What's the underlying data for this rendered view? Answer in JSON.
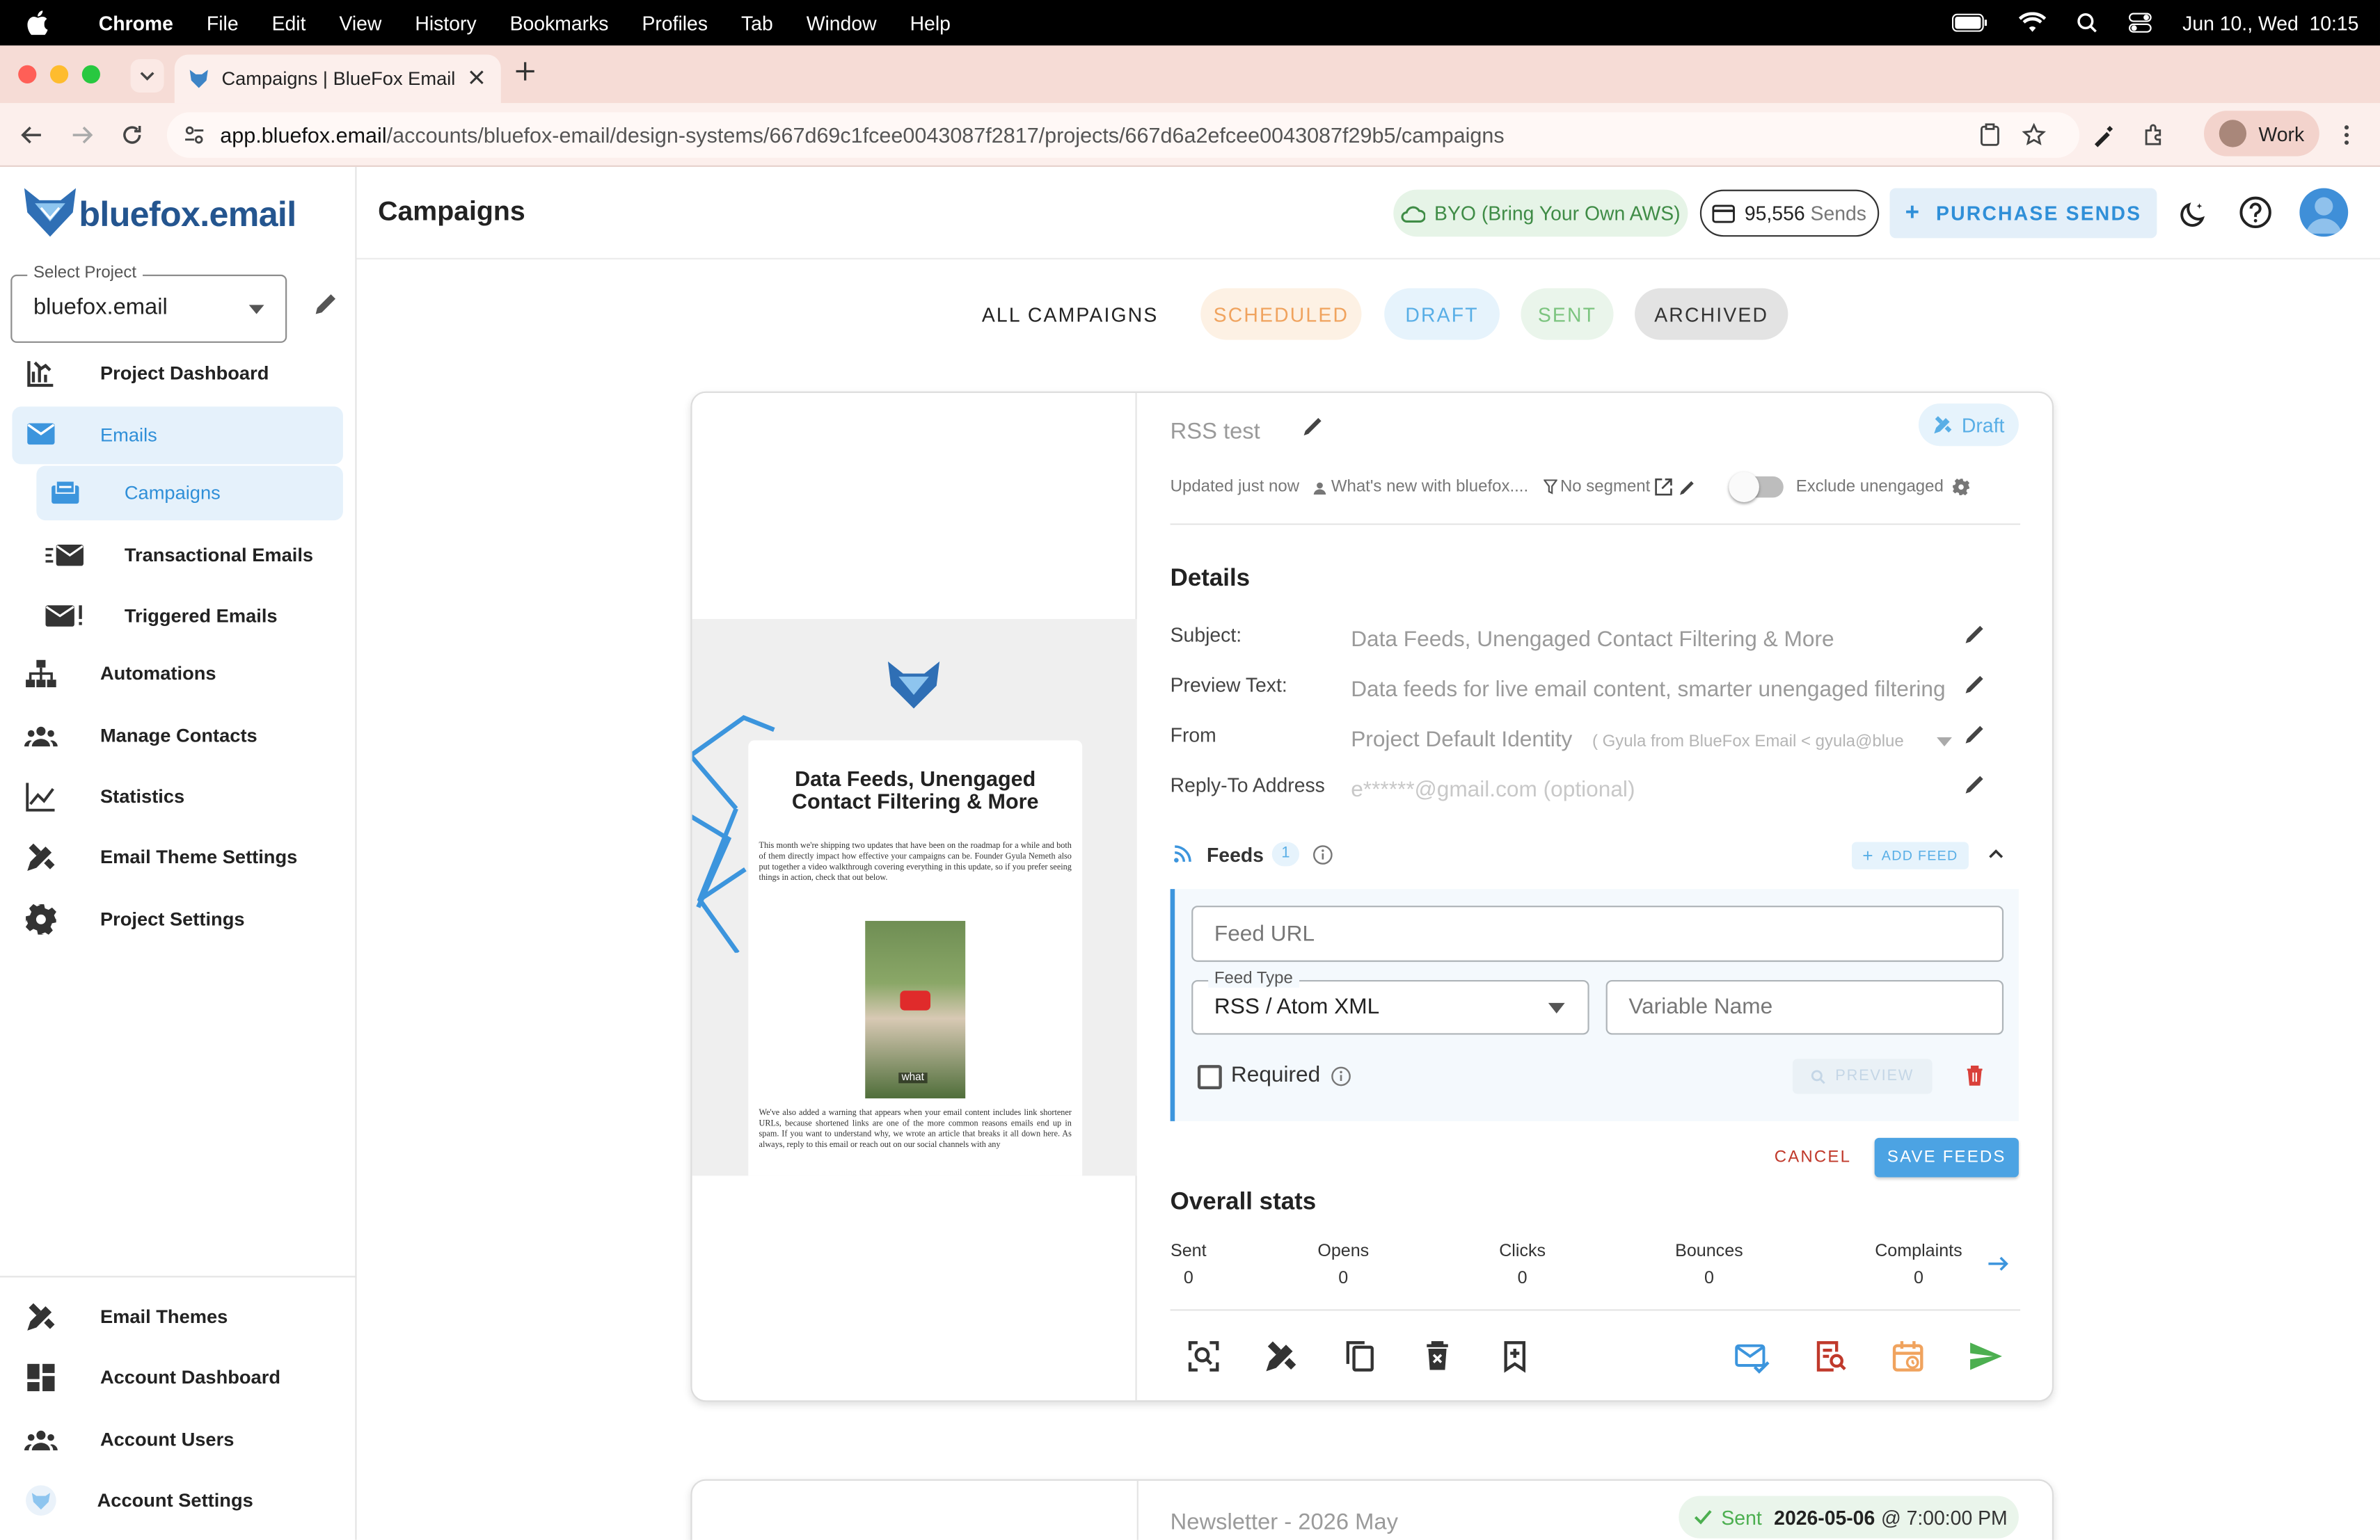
{
  "mac_menu": {
    "app": "Chrome",
    "items": [
      "File",
      "Edit",
      "View",
      "History",
      "Bookmarks",
      "Profiles",
      "Tab",
      "Window",
      "Help"
    ],
    "datetime": "Jun 10., Wed  10:15"
  },
  "browser": {
    "tab_title": "Campaigns | BlueFox Email",
    "url_host": "app.bluefox.email",
    "url_path": "/accounts/bluefox-email/design-systems/667d69c1fcee0043087f2817/projects/667d6a2efcee0043087f29b5/campaigns",
    "profile": "Work"
  },
  "sidebar": {
    "logo_text": "bluefox.email",
    "project_select_label": "Select Project",
    "project_select_value": "bluefox.email",
    "nav": [
      {
        "label": "Project Dashboard",
        "icon": "dashboard-chart-icon"
      },
      {
        "label": "Emails",
        "icon": "mail-icon"
      },
      {
        "label": "Campaigns",
        "icon": "campaign-icon"
      },
      {
        "label": "Transactional Emails",
        "icon": "fast-mail-icon"
      },
      {
        "label": "Triggered Emails",
        "icon": "mail-alert-icon"
      },
      {
        "label": "Automations",
        "icon": "sitemap-icon"
      },
      {
        "label": "Manage Contacts",
        "icon": "people-icon"
      },
      {
        "label": "Statistics",
        "icon": "line-chart-icon"
      },
      {
        "label": "Email Theme Settings",
        "icon": "pencil-ruler-icon"
      },
      {
        "label": "Project Settings",
        "icon": "gear-icon"
      }
    ],
    "bottom_nav": [
      {
        "label": "Email Themes",
        "icon": "pencil-ruler-icon"
      },
      {
        "label": "Account Dashboard",
        "icon": "grid-icon"
      },
      {
        "label": "Account Users",
        "icon": "people-icon"
      },
      {
        "label": "Account Settings",
        "icon": "account-logo-icon"
      }
    ]
  },
  "header": {
    "title": "Campaigns",
    "byo_label": "BYO (Bring Your Own AWS)",
    "sends_count": "95,556",
    "sends_label": "Sends",
    "purchase_label": "PURCHASE SENDS"
  },
  "filters": [
    {
      "label": "ALL CAMPAIGNS",
      "color": "#222222"
    },
    {
      "label": "SCHEDULED",
      "color": "#f0a35e"
    },
    {
      "label": "DRAFT",
      "color": "#58aee6"
    },
    {
      "label": "SENT",
      "color": "#7cc47f"
    },
    {
      "label": "ARCHIVED",
      "color": "#333333"
    }
  ],
  "campaign": {
    "name": "RSS test",
    "status_badge": "Draft",
    "updated": "Updated just now",
    "list_name": "What's new with bluefox....",
    "segment": "No segment",
    "exclude_unengaged_label": "Exclude unengaged",
    "details_heading": "Details",
    "details": {
      "subject_label": "Subject:",
      "subject_value": "Data Feeds, Unengaged Contact Filtering & More",
      "preview_label": "Preview Text:",
      "preview_value": "Data feeds for live email content, smarter unengaged filtering",
      "from_label": "From",
      "from_value": "Project Default Identity",
      "from_sub": "( Gyula from BlueFox Email < gyula@blue",
      "reply_label": "Reply-To Address",
      "reply_placeholder": "e******@gmail.com (optional)"
    },
    "feeds": {
      "label": "Feeds",
      "count": "1",
      "add_label": "ADD FEED",
      "url_placeholder": "Feed URL",
      "type_label": "Feed Type",
      "type_value": "RSS / Atom XML",
      "var_placeholder": "Variable Name",
      "required_label": "Required",
      "preview_label": "PREVIEW",
      "cancel_label": "CANCEL",
      "save_label": "SAVE FEEDS"
    },
    "stats_heading": "Overall stats",
    "stats": [
      {
        "label": "Sent",
        "value": "0"
      },
      {
        "label": "Opens",
        "value": "0"
      },
      {
        "label": "Clicks",
        "value": "0"
      },
      {
        "label": "Bounces",
        "value": "0"
      },
      {
        "label": "Complaints",
        "value": "0"
      }
    ],
    "preview": {
      "headline": "Data Feeds, Unengaged Contact Filtering & More",
      "para1": "This month we're shipping two updates that have been on the roadmap for a while and both of them directly impact how effective your campaigns can be. Founder Gyula Nemeth also put together a video walkthrough covering everything in this update, so if you prefer seeing things in action, check that out below.",
      "video_caption": "what",
      "para2": "We've also added a warning that appears when your email content includes link shortener URLs, because shortened links are one of the more common reasons emails end up in spam. If you want to understand why, we wrote an article that breaks it all down here. As always, reply to this email or reach out on our social channels with any"
    }
  },
  "campaign2": {
    "name": "Newsletter - 2026 May",
    "status": "Sent",
    "date": "2026-05-06",
    "time": "@ 7:00:00 PM"
  }
}
